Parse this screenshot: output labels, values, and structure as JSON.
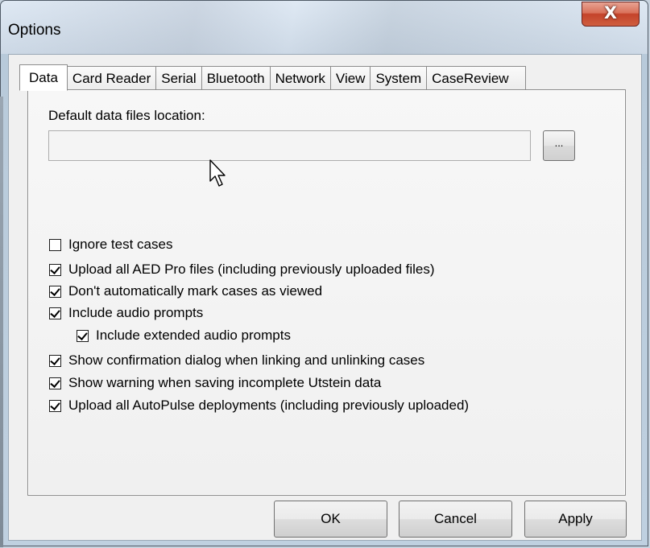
{
  "window": {
    "title": "Options",
    "close_glyph": "X"
  },
  "tabs": [
    {
      "label": "Data",
      "active": true
    },
    {
      "label": "Card Reader",
      "active": false
    },
    {
      "label": "Serial",
      "active": false
    },
    {
      "label": "Bluetooth",
      "active": false
    },
    {
      "label": "Network",
      "active": false
    },
    {
      "label": "View",
      "active": false
    },
    {
      "label": "System",
      "active": false
    },
    {
      "label": "CaseReview",
      "active": false
    }
  ],
  "data_tab": {
    "location_label": "Default data files location:",
    "location_value": "",
    "browse_label": "...",
    "checkboxes": [
      {
        "label": "Ignore test cases",
        "checked": false
      },
      {
        "label": "Upload all AED Pro files (including previously uploaded files)",
        "checked": true
      },
      {
        "label": "Don't automatically mark cases as viewed",
        "checked": true
      },
      {
        "label": "Include audio prompts",
        "checked": true
      },
      {
        "label": "Include extended audio prompts",
        "checked": true
      },
      {
        "label": "Show confirmation dialog when linking and unlinking cases",
        "checked": true
      },
      {
        "label": "Show warning when saving incomplete Utstein data",
        "checked": true
      },
      {
        "label": "Upload all AutoPulse deployments (including previously uploaded)",
        "checked": true
      }
    ]
  },
  "buttons": {
    "ok": "OK",
    "cancel": "Cancel",
    "apply": "Apply"
  },
  "icons": {
    "cursor": "arrow-cursor-icon",
    "close": "close-icon"
  }
}
